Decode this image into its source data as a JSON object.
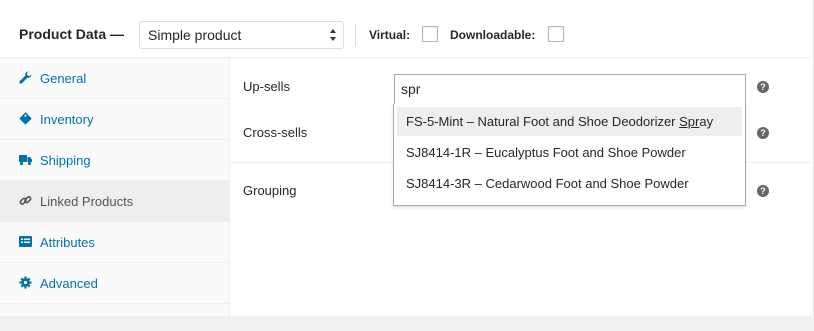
{
  "header": {
    "title": "Product Data —",
    "product_type": "Simple product",
    "virtual_label": "Virtual:",
    "virtual_checked": false,
    "downloadable_label": "Downloadable:",
    "downloadable_checked": false
  },
  "tabs": [
    {
      "label": "General",
      "icon": "wrench-icon",
      "active": false
    },
    {
      "label": "Inventory",
      "icon": "tag-icon",
      "active": false
    },
    {
      "label": "Shipping",
      "icon": "truck-icon",
      "active": false
    },
    {
      "label": "Linked Products",
      "icon": "link-icon",
      "active": true
    },
    {
      "label": "Attributes",
      "icon": "list-icon",
      "active": false
    },
    {
      "label": "Advanced",
      "icon": "gear-icon",
      "active": false
    }
  ],
  "fields": {
    "upsells_label": "Up-sells",
    "crosssells_label": "Cross-sells",
    "grouping_label": "Grouping",
    "help_glyph": "?"
  },
  "search": {
    "value": "spr"
  },
  "results": [
    {
      "before": "FS-5-Mint – Natural Foot and Shoe Deodorizer ",
      "match": "Spr",
      "after": "ay",
      "highlighted": true
    },
    {
      "before": "SJ8414-1R – Eucalyptus Foot and Shoe Powder",
      "match": "",
      "after": "",
      "highlighted": false
    },
    {
      "before": "SJ8414-3R – Cedarwood Foot and Shoe Powder",
      "match": "",
      "after": "",
      "highlighted": false
    }
  ],
  "colors": {
    "link": "#0073aa",
    "active_tab_bg": "#eeeeee",
    "help_bg": "#666666"
  }
}
